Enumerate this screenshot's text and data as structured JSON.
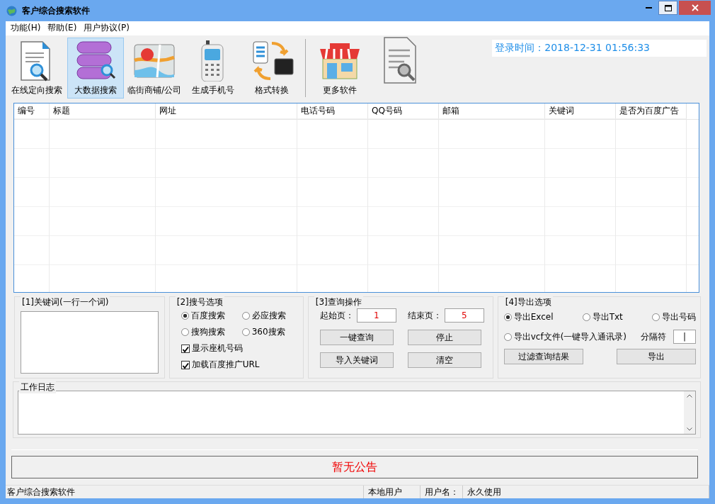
{
  "window": {
    "title": "客户综合搜索软件"
  },
  "menu": [
    {
      "label": "功能(H)"
    },
    {
      "label": "帮助(E)"
    },
    {
      "label": "用户协议(P)"
    }
  ],
  "toolbar": [
    {
      "label": "在线定向搜索",
      "selected": false
    },
    {
      "label": "大数据搜索",
      "selected": true
    },
    {
      "label": "临街商铺/公司",
      "selected": false
    },
    {
      "label": "生成手机号",
      "selected": false
    },
    {
      "label": "格式转换",
      "selected": false
    },
    {
      "label": "更多软件",
      "selected": false
    }
  ],
  "login_time": "登录时间：2018-12-31 01:56:33",
  "table": {
    "columns": [
      "编号",
      "标题",
      "网址",
      "电话号码",
      "QQ号码",
      "邮箱",
      "关键词",
      "是否为百度广告"
    ]
  },
  "keywords": {
    "title": "[1]关键词(一行一个词)"
  },
  "search_options": {
    "title": "[2]搜号选项",
    "engines": [
      {
        "label": "百度搜索",
        "selected": true
      },
      {
        "label": "必应搜索",
        "selected": false
      },
      {
        "label": "搜狗搜索",
        "selected": false
      },
      {
        "label": "360搜索",
        "selected": false
      }
    ],
    "checks": [
      {
        "label": "显示座机号码",
        "checked": true
      },
      {
        "label": "加载百度推广URL",
        "checked": true
      }
    ]
  },
  "query": {
    "title": "[3]查询操作",
    "start_label": "起始页：",
    "start_value": "1",
    "end_label": "结束页：",
    "end_value": "5",
    "buttons": [
      "一键查询",
      "停止",
      "导入关键词",
      "清空"
    ]
  },
  "export": {
    "title": "[4]导出选项",
    "formats": [
      {
        "label": "导出Excel",
        "selected": true
      },
      {
        "label": "导出Txt",
        "selected": false
      },
      {
        "label": "导出号码",
        "selected": false
      },
      {
        "label": "导出vcf文件(一键导入通讯录)",
        "selected": false
      }
    ],
    "separator_label": "分隔符",
    "separator_value": "|",
    "buttons": [
      "过滤查询结果",
      "导出"
    ]
  },
  "work_log": {
    "title": "工作日志"
  },
  "notice": "暂无公告",
  "status_bar": [
    "客户综合搜索软件",
    "本地用户",
    "用户名：",
    "永久使用"
  ]
}
